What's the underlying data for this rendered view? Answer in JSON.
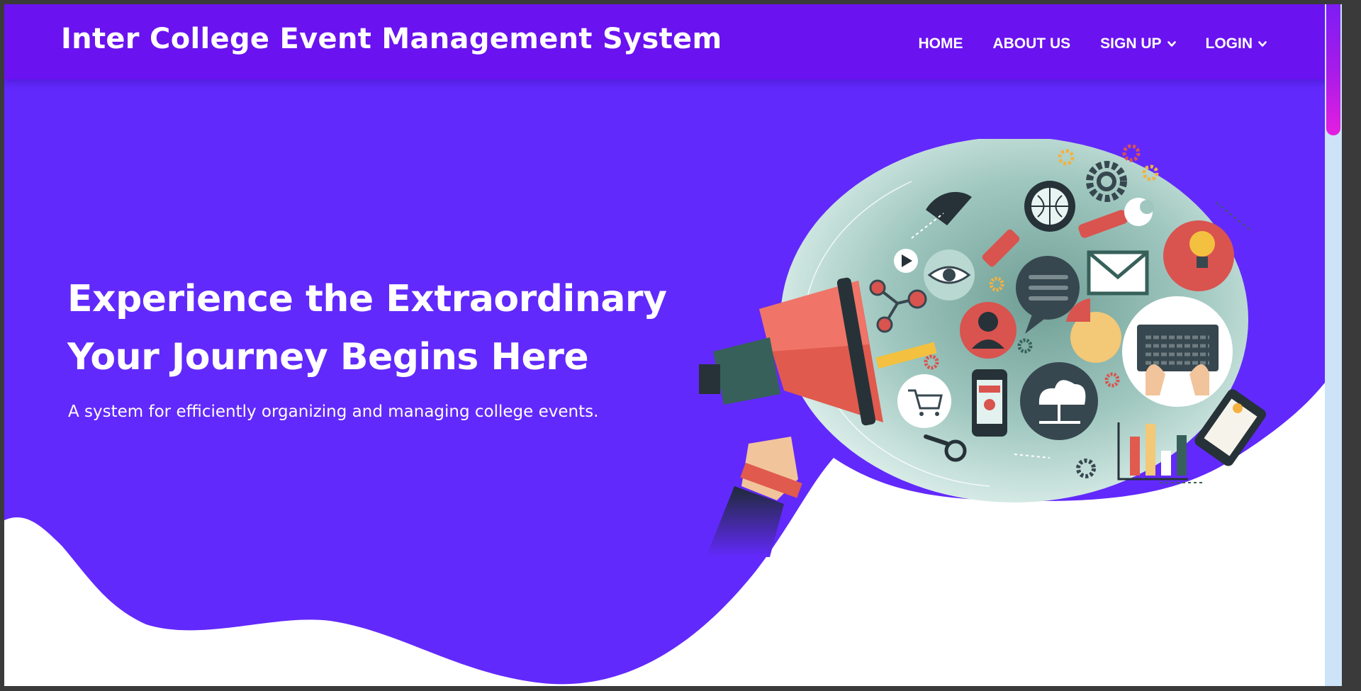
{
  "header": {
    "brand": "Inter College Event Management System",
    "nav": {
      "home": "HOME",
      "about": "ABOUT US",
      "signup": "SIGN UP",
      "login": "LOGIN"
    }
  },
  "hero": {
    "headline_line1": "Experience the Extraordinary",
    "headline_line2": "Your Journey Begins Here",
    "subtitle": "A system for efficiently organizing and managing college events."
  },
  "colors": {
    "navbar": "#6a12f0",
    "hero": "#6229fc",
    "scroll_thumb": "#a61ce8"
  },
  "icons": [
    "chevron-down-icon",
    "megaphone-icon",
    "magnifier-globe-icon",
    "gear-icon",
    "wrench-icon",
    "lightbulb-icon",
    "envelope-icon",
    "chat-bubble-icon",
    "eye-icon",
    "pie-chart-icon",
    "user-icon",
    "laptop-icon",
    "cloud-icon",
    "smartphone-icon",
    "shopping-cart-icon",
    "bar-chart-icon",
    "tablet-icon",
    "pencil-icon",
    "phone-icon"
  ]
}
